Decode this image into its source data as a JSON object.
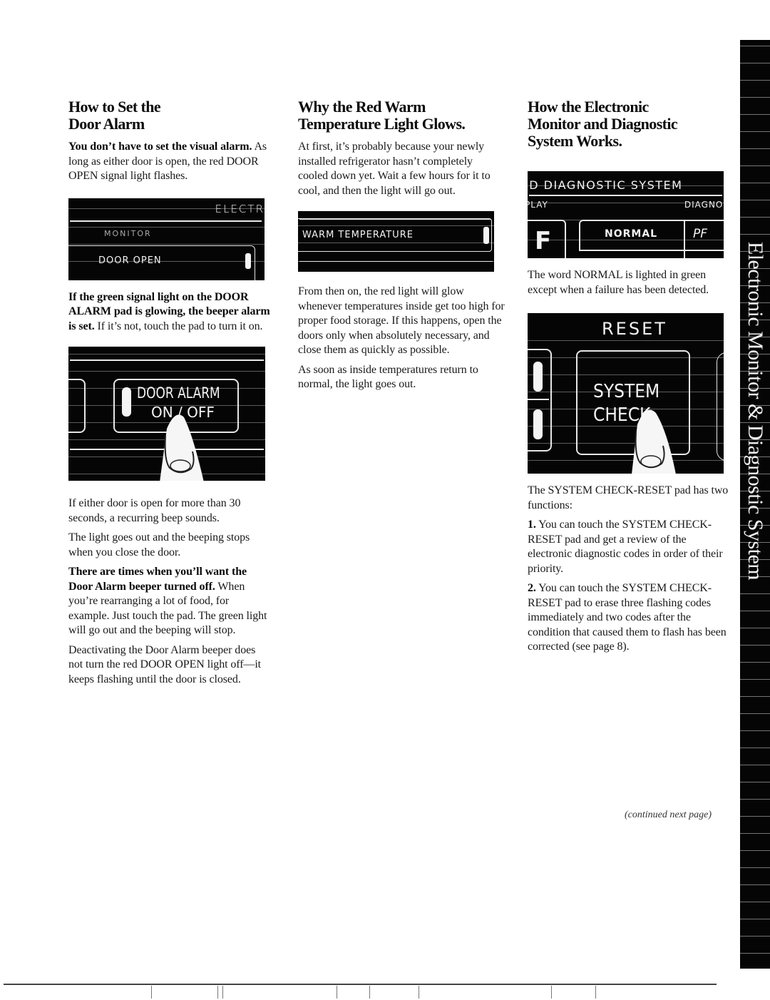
{
  "page": {
    "side_tab_title": "Electronic Monitor & Diagnostic System",
    "continued": "(continued next page)"
  },
  "col1": {
    "heading_line1": "How to Set the",
    "heading_line2": "Door Alarm",
    "p1_bold": "You don’t have to set the visual alarm.",
    "p1_rest": " As long as either door is open, the red DOOR OPEN signal light flashes.",
    "panel1": {
      "top_label": "ELECTR",
      "mid_label": "MONITOR",
      "pad_label": "DOOR OPEN"
    },
    "p2_bold": "If the green signal light on the DOOR ALARM pad is glowing, the beeper alarm is set.",
    "p2_rest": " If it’s not, touch the pad to turn it on.",
    "panel2": {
      "pad_line1": "DOOR ALARM",
      "pad_line2": "ON / OFF"
    },
    "p3": "If either door is open for more than 30 seconds, a recurring beep sounds.",
    "p4": "The light goes out and the beeping stops when you close the door.",
    "p5_bold": "There are times when you’ll want the Door Alarm beeper turned off.",
    "p5_rest": " When you’re rearranging a lot of food, for example. Just touch the pad. The green light will go out and the beeping will stop.",
    "p6": "Deactivating the Door Alarm beeper does not turn the red DOOR OPEN light off—it keeps flashing until the door is closed."
  },
  "col2": {
    "heading_line1": "Why the Red Warm",
    "heading_line2": "Temperature Light Glows.",
    "p1": "At first, it’s probably because your newly installed refrigerator hasn’t completely cooled down yet. Wait a few hours for it to cool, and then the light will go out.",
    "panel": {
      "pad_label": "WARM TEMPERATURE"
    },
    "p2": "From then on, the red light will glow whenever temperatures inside get too high for proper food storage. If this happens, open the doors only when absolutely necessary, and close them as quickly as possible.",
    "p3": "As soon as inside temperatures return to normal, the light goes out."
  },
  "col3": {
    "heading_line1": "How the Electronic",
    "heading_line2": "Monitor and Diagnostic",
    "heading_line3": "System Works.",
    "panel1": {
      "title": "ID DIAGNOSTIC SYSTEM",
      "left_label": "PLAY",
      "right_label": "DIAGNOS",
      "digit": "F",
      "status": "NORMAL",
      "code": "PF"
    },
    "p1": "The word NORMAL is lighted in green except when a failure has been detected.",
    "panel2": {
      "top_label": "RESET",
      "pad_line1": "SYSTEM",
      "pad_line2": "CHECK"
    },
    "p2": "The SYSTEM CHECK-RESET pad has two functions:",
    "item1_num": "1.",
    "item1_text": " You can touch the SYSTEM CHECK-RESET pad and get a review of the electronic diagnostic codes in order of their priority.",
    "item2_num": "2.",
    "item2_text": " You can touch the SYSTEM CHECK-RESET pad to erase three flashing codes immediately and two codes after the condition that caused them to flash has been corrected (see page 8)."
  }
}
